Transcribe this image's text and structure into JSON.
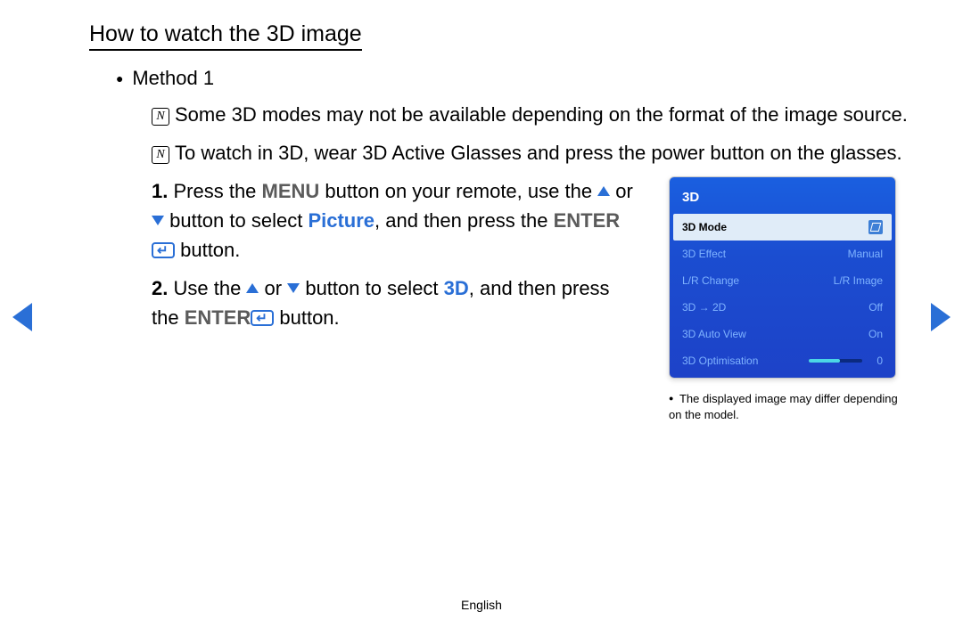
{
  "title": "How to watch the 3D image",
  "method_label": "Method 1",
  "notes": {
    "n1": "Some 3D modes may not be available depending on the format of the image source.",
    "n2": "To watch in 3D, wear 3D Active Glasses and press the power button on the glasses."
  },
  "steps": {
    "s1": {
      "num": "1.",
      "pre": "Press the ",
      "menu": "MENU",
      "mid1": " button on your remote, use the ",
      "or": " or ",
      "mid2": " button to select ",
      "picture": "Picture",
      "mid3": ", and then press the ",
      "enter": "ENTER",
      "post": " button."
    },
    "s2": {
      "num": "2.",
      "pre": "Use the ",
      "or": " or ",
      "mid1": " button to select ",
      "threeD": "3D",
      "mid2": ", and then press the ",
      "enter": "ENTER",
      "post": " button."
    }
  },
  "panel": {
    "title": "3D",
    "rows": {
      "mode": {
        "label": "3D Mode"
      },
      "effect": {
        "label": "3D Effect",
        "value": "Manual"
      },
      "lr": {
        "label": "L/R Change",
        "value": "L/R Image"
      },
      "to2d": {
        "label": "3D → 2D",
        "value": "Off"
      },
      "auto": {
        "label": "3D Auto View",
        "value": "On"
      },
      "opt": {
        "label": "3D Optimisation",
        "value": "0"
      }
    },
    "caption": "The displayed image may differ depending on the model."
  },
  "footer": "English",
  "note_glyph": "N"
}
